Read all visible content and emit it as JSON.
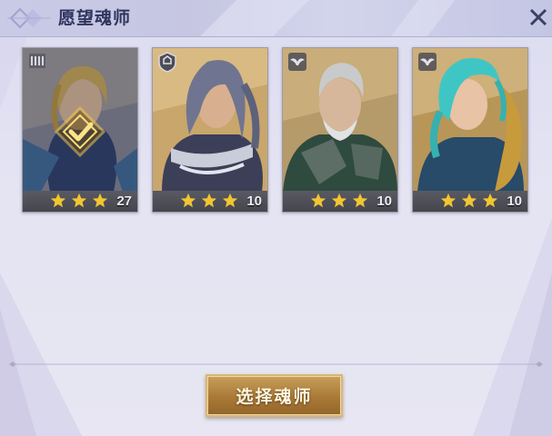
{
  "dialog": {
    "title": "愿望魂师",
    "close_icon": "close-icon",
    "accent_color": "#2f355e"
  },
  "cards": [
    {
      "level": "27",
      "stars": 3,
      "selected": true,
      "faction_icon": "banner-icon",
      "hair_color": "#d9b457",
      "outfit_color": "#2b3f6d"
    },
    {
      "level": "10",
      "stars": 3,
      "selected": false,
      "faction_icon": "shield-icon",
      "hair_color": "#6f7590",
      "outfit_color": "#3c3f58"
    },
    {
      "level": "10",
      "stars": 3,
      "selected": false,
      "faction_icon": "bird-icon",
      "hair_color": "#c8cacc",
      "outfit_color": "#2f4a3e"
    },
    {
      "level": "10",
      "stars": 3,
      "selected": false,
      "faction_icon": "bird-icon",
      "hair_color": "#3fc6c4",
      "outfit_color": "#274b68"
    }
  ],
  "actions": {
    "select_label": "选择魂师"
  },
  "colors": {
    "star": "#f2c531",
    "button_gold": "#b3843f"
  }
}
